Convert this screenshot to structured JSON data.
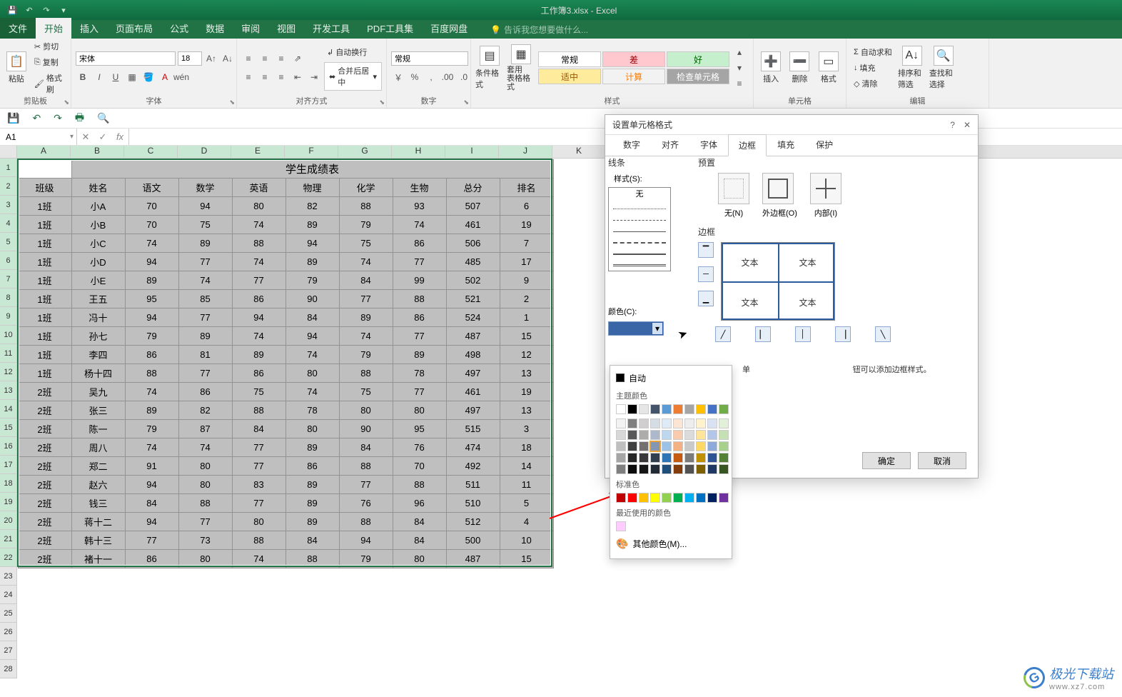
{
  "titlebar": {
    "title": "工作簿3.xlsx - Excel"
  },
  "menu": {
    "file": "文件",
    "home": "开始",
    "insert": "插入",
    "layout": "页面布局",
    "formulas": "公式",
    "data": "数据",
    "review": "审阅",
    "view": "视图",
    "dev": "开发工具",
    "pdf": "PDF工具集",
    "baidu": "百度网盘",
    "tellme": "告诉我您想要做什么..."
  },
  "ribbon": {
    "clipboard": {
      "paste": "粘贴",
      "cut": "剪切",
      "copy": "复制",
      "format_painter": "格式刷",
      "label": "剪贴板"
    },
    "font": {
      "name": "宋体",
      "size": "18",
      "label": "字体"
    },
    "align": {
      "wrap": "自动换行",
      "merge": "合并后居中",
      "label": "对齐方式"
    },
    "number": {
      "format": "常规",
      "label": "数字"
    },
    "styles": {
      "cond": "条件格式",
      "table": "套用\n表格格式",
      "normal": "常规",
      "bad": "差",
      "good": "好",
      "neutral": "适中",
      "calc": "计算",
      "check": "检查单元格",
      "label": "样式"
    },
    "cells": {
      "insert": "插入",
      "delete": "删除",
      "format": "格式",
      "label": "单元格"
    },
    "editing": {
      "sum": "自动求和",
      "fill": "填充",
      "clear": "清除",
      "sort": "排序和筛选",
      "find": "查找和选择",
      "label": "编辑"
    }
  },
  "namebox": "A1",
  "columns": [
    "A",
    "B",
    "C",
    "D",
    "E",
    "F",
    "G",
    "H",
    "I",
    "J",
    "K"
  ],
  "table": {
    "title": "学生成绩表",
    "headers": [
      "班级",
      "姓名",
      "语文",
      "数学",
      "英语",
      "物理",
      "化学",
      "生物",
      "总分",
      "排名"
    ],
    "rows": [
      [
        "1班",
        "小A",
        "70",
        "94",
        "80",
        "82",
        "88",
        "93",
        "507",
        "6"
      ],
      [
        "1班",
        "小B",
        "70",
        "75",
        "74",
        "89",
        "79",
        "74",
        "461",
        "19"
      ],
      [
        "1班",
        "小C",
        "74",
        "89",
        "88",
        "94",
        "75",
        "86",
        "506",
        "7"
      ],
      [
        "1班",
        "小D",
        "94",
        "77",
        "74",
        "89",
        "74",
        "77",
        "485",
        "17"
      ],
      [
        "1班",
        "小E",
        "89",
        "74",
        "77",
        "79",
        "84",
        "99",
        "502",
        "9"
      ],
      [
        "1班",
        "王五",
        "95",
        "85",
        "86",
        "90",
        "77",
        "88",
        "521",
        "2"
      ],
      [
        "1班",
        "冯十",
        "94",
        "77",
        "94",
        "84",
        "89",
        "86",
        "524",
        "1"
      ],
      [
        "1班",
        "孙七",
        "79",
        "89",
        "74",
        "94",
        "74",
        "77",
        "487",
        "15"
      ],
      [
        "1班",
        "李四",
        "86",
        "81",
        "89",
        "74",
        "79",
        "89",
        "498",
        "12"
      ],
      [
        "1班",
        "杨十四",
        "88",
        "77",
        "86",
        "80",
        "88",
        "78",
        "497",
        "13"
      ],
      [
        "2班",
        "吴九",
        "74",
        "86",
        "75",
        "74",
        "75",
        "77",
        "461",
        "19"
      ],
      [
        "2班",
        "张三",
        "89",
        "82",
        "88",
        "78",
        "80",
        "80",
        "497",
        "13"
      ],
      [
        "2班",
        "陈一",
        "79",
        "87",
        "84",
        "80",
        "90",
        "95",
        "515",
        "3"
      ],
      [
        "2班",
        "周八",
        "74",
        "74",
        "77",
        "89",
        "84",
        "76",
        "474",
        "18"
      ],
      [
        "2班",
        "郑二",
        "91",
        "80",
        "77",
        "86",
        "88",
        "70",
        "492",
        "14"
      ],
      [
        "2班",
        "赵六",
        "94",
        "80",
        "83",
        "89",
        "77",
        "88",
        "511",
        "11"
      ],
      [
        "2班",
        "钱三",
        "84",
        "88",
        "77",
        "89",
        "76",
        "96",
        "510",
        "5"
      ],
      [
        "2班",
        "蒋十二",
        "94",
        "77",
        "80",
        "89",
        "88",
        "84",
        "512",
        "4"
      ],
      [
        "2班",
        "韩十三",
        "77",
        "73",
        "88",
        "84",
        "94",
        "84",
        "500",
        "10"
      ],
      [
        "2班",
        "褚十一",
        "86",
        "80",
        "74",
        "88",
        "79",
        "80",
        "487",
        "15"
      ]
    ]
  },
  "dialog": {
    "title": "设置单元格格式",
    "tabs": {
      "number": "数字",
      "align": "对齐",
      "font": "字体",
      "border": "边框",
      "fill": "填充",
      "protect": "保护"
    },
    "line_section": "线条",
    "style_label": "样式(S):",
    "style_none": "无",
    "preset_section": "预置",
    "presets": {
      "none_label": "无(N)",
      "outline_label": "外边框(O)",
      "inside_label": "内部(I)"
    },
    "border_section": "边框",
    "color_label": "颜色(C):",
    "preview_text": "文本",
    "help": "钮可以添加边框样式。",
    "help_prefix": "单",
    "ok": "确定",
    "cancel": "取消"
  },
  "color_popup": {
    "auto": "自动",
    "theme_label": "主题颜色",
    "standard_label": "标准色",
    "recent_label": "最近使用的颜色",
    "more": "其他颜色(M)...",
    "theme_row1": [
      "#ffffff",
      "#000000",
      "#e7e6e6",
      "#44546a",
      "#5b9bd5",
      "#ed7d31",
      "#a5a5a5",
      "#ffc000",
      "#4472c4",
      "#70ad47"
    ],
    "theme_shades": [
      [
        "#f2f2f2",
        "#7f7f7f",
        "#d0cece",
        "#d6dce4",
        "#deebf6",
        "#fbe5d5",
        "#ededed",
        "#fff2cc",
        "#d9e2f3",
        "#e2efd9"
      ],
      [
        "#d8d8d8",
        "#595959",
        "#aeabab",
        "#adb9ca",
        "#bdd7ee",
        "#f7cbac",
        "#dbdbdb",
        "#fee599",
        "#b4c6e7",
        "#c5e0b3"
      ],
      [
        "#bfbfbf",
        "#3f3f3f",
        "#757070",
        "#8496b0",
        "#9cc3e5",
        "#f4b183",
        "#c9c9c9",
        "#ffd965",
        "#8eaadb",
        "#a8d08d"
      ],
      [
        "#a5a5a5",
        "#262626",
        "#3a3838",
        "#323f4f",
        "#2e75b5",
        "#c55a11",
        "#7b7b7b",
        "#bf9000",
        "#2f5496",
        "#538135"
      ],
      [
        "#7f7f7f",
        "#0c0c0c",
        "#171616",
        "#222a35",
        "#1e4e79",
        "#833c0b",
        "#525252",
        "#7f6000",
        "#1f3864",
        "#375623"
      ]
    ],
    "standard": [
      "#c00000",
      "#ff0000",
      "#ffc000",
      "#ffff00",
      "#92d050",
      "#00b050",
      "#00b0f0",
      "#0070c0",
      "#002060",
      "#7030a0"
    ],
    "recent": [
      "#ffccff"
    ]
  },
  "watermark": {
    "brand": "极光下载站",
    "url": "www.xz7.com"
  }
}
